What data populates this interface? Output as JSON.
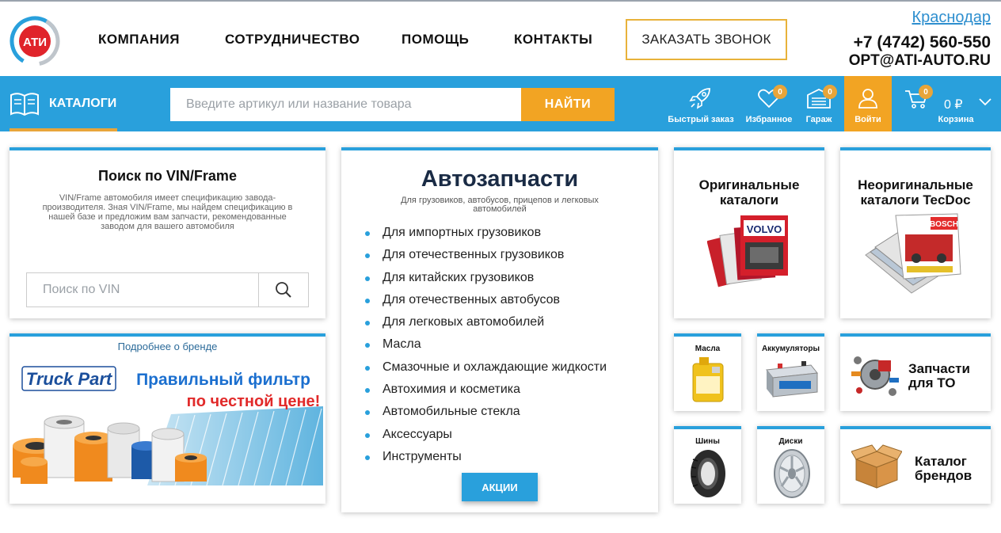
{
  "header": {
    "logo_text": "АТИ",
    "nav": [
      "КОМПАНИЯ",
      "СОТРУДНИЧЕСТВО",
      "ПОМОЩЬ",
      "КОНТАКТЫ"
    ],
    "call_button": "ЗАКАЗАТЬ ЗВОНОК",
    "city": "Краснодар",
    "phone": "+7 (4742) 560-550",
    "email": "OPT@ATI-AUTO.RU"
  },
  "bar": {
    "catalogs_label": "КАТАЛОГИ",
    "search_placeholder": "Введите артикул или название товара",
    "find_button": "НАЙТИ",
    "tools": {
      "quick_order": "Быстрый заказ",
      "favorites": "Избранное",
      "favorites_count": "0",
      "garage": "Гараж",
      "garage_count": "0",
      "login": "Войти",
      "cart": "Корзина",
      "cart_count": "0",
      "cart_total": "0 ₽"
    }
  },
  "vin": {
    "title": "Поиск по VIN/Frame",
    "description": "VIN/Frame автомобиля имеет спецификацию завода-производителя. Зная VIN/Frame, мы найдем спецификацию в нашей базе и предложим вам запчасти, рекомендованные заводом для вашего автомобиля",
    "placeholder": "Поиск по VIN"
  },
  "brand": {
    "link": "Подробнее о бренде",
    "banner_logo": "Truck Part",
    "banner_line1": "Правильный фильтр",
    "banner_line2": "по честной цене!"
  },
  "autoparts": {
    "title": "Автозапчасти",
    "subtitle": "Для грузовиков, автобусов, прицепов и легковых автомобилей",
    "items": [
      "Для импортных грузовиков",
      "Для отечественных грузовиков",
      "Для китайских грузовиков",
      "Для отечественных автобусов",
      "Для легковых автомобилей",
      "Масла",
      "Смазочные и охлаждающие жидкости",
      "Автохимия и косметика",
      "Автомобильные стекла",
      "Аксессуары",
      "Инструменты"
    ],
    "promo_button": "АКЦИИ"
  },
  "catalogs": {
    "original": "Оригинальные каталоги",
    "original_cover": "VOLVO",
    "tecdoc": "Неоригинальные каталоги TecDoc",
    "tecdoc_cover": "BOSCH"
  },
  "categories": {
    "oils": "Масла",
    "batteries": "Аккумуляторы",
    "service_parts": "Запчасти для ТО",
    "tires": "Шины",
    "wheels": "Диски",
    "brand_catalog": "Каталог брендов"
  },
  "colors": {
    "accent": "#29a0dc",
    "orange": "#f2a423",
    "navy": "#1a2b45"
  }
}
